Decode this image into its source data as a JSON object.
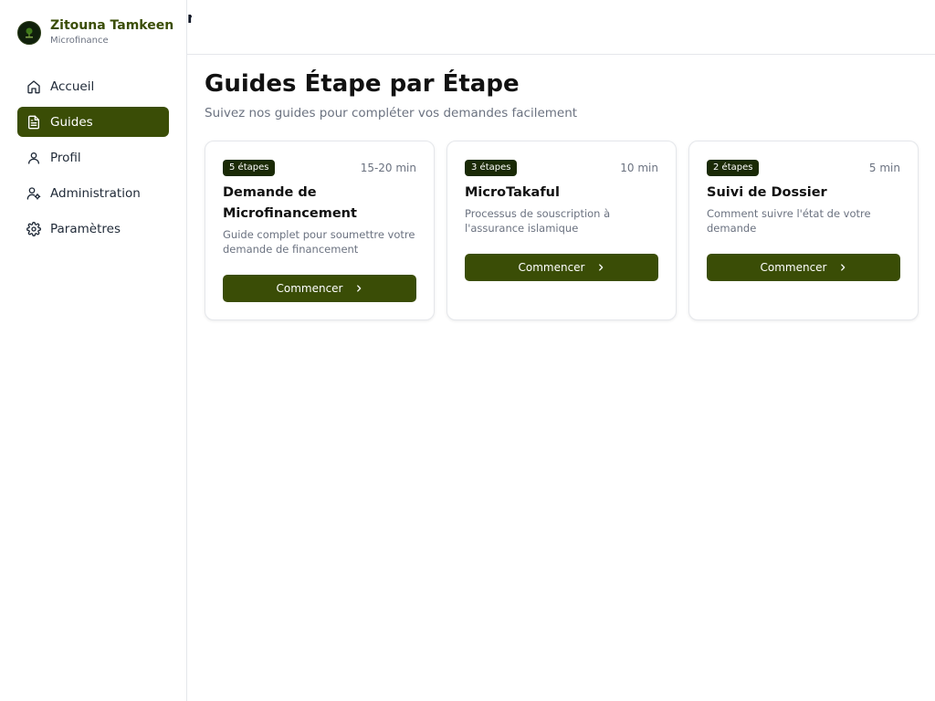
{
  "brand": {
    "name": "Zitouna Tamkeen",
    "subtitle": "Microfinance"
  },
  "colors": {
    "accent": "#3a4d06",
    "badge": "#1a2a06",
    "muted": "#6b7280"
  },
  "nav": [
    {
      "label": "Accueil",
      "icon": "home-icon",
      "active": false
    },
    {
      "label": "Guides",
      "icon": "document-icon",
      "active": true
    },
    {
      "label": "Profil",
      "icon": "user-icon",
      "active": false
    },
    {
      "label": "Administration",
      "icon": "user-cog-icon",
      "active": false
    },
    {
      "label": "Paramètres",
      "icon": "gear-icon",
      "active": false
    }
  ],
  "topbar": {
    "partial_text": "n"
  },
  "page": {
    "title": "Guides Étape par Étape",
    "subtitle": "Suivez nos guides pour compléter vos demandes facilement"
  },
  "guides": [
    {
      "steps": "5 étapes",
      "duration": "15-20 min",
      "title": "Demande de Microfinancement",
      "description": "Guide complet pour soumettre votre demande de financement",
      "button": "Commencer"
    },
    {
      "steps": "3 étapes",
      "duration": "10 min",
      "title": "MicroTakaful",
      "description": "Processus de souscription à l'assurance islamique",
      "button": "Commencer"
    },
    {
      "steps": "2 étapes",
      "duration": "5 min",
      "title": "Suivi de Dossier",
      "description": "Comment suivre l'état de votre demande",
      "button": "Commencer"
    }
  ]
}
